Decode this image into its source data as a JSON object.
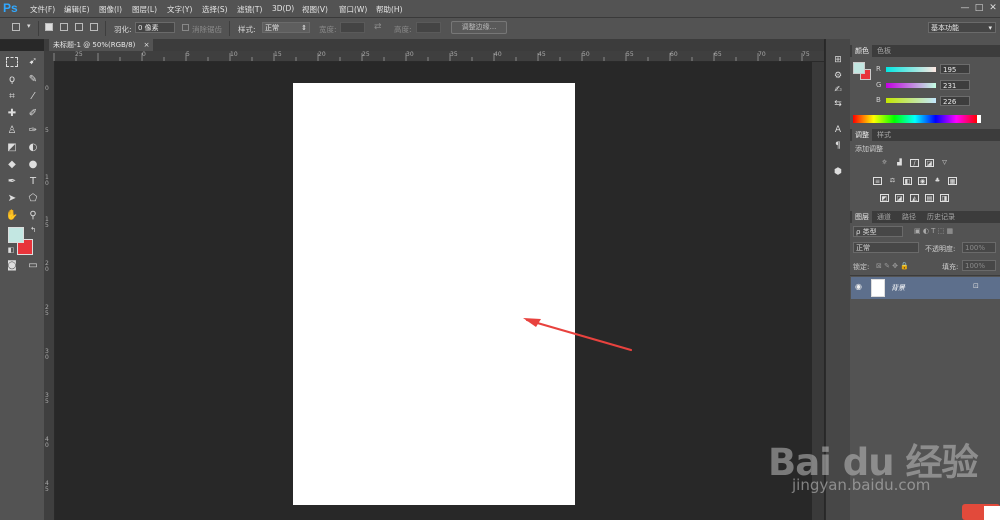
{
  "menubar": {
    "logo": "Ps",
    "items": [
      "文件(F)",
      "编辑(E)",
      "图像(I)",
      "图层(L)",
      "文字(Y)",
      "选择(S)",
      "滤镜(T)",
      "3D(D)",
      "视图(V)",
      "窗口(W)",
      "帮助(H)"
    ],
    "window_controls": [
      "—",
      "□",
      "✕"
    ]
  },
  "options": {
    "feather_label": "羽化:",
    "feather_value": "0 像素",
    "antialias_label": "消除锯齿",
    "style_label": "样式:",
    "style_value": "正常",
    "width_label": "宽度:",
    "height_label": "高度:",
    "refine_edge_button": "调整边缘...",
    "workspace_value": "基本功能"
  },
  "document": {
    "tab_title": "未标题-1 @ 50%(RGB/8)",
    "tab_close": "×"
  },
  "rulers": {
    "top_labels": [
      "25",
      "0",
      "5",
      "10",
      "15",
      "20",
      "25",
      "30",
      "35",
      "40",
      "45",
      "50",
      "55",
      "60",
      "65",
      "70",
      "75",
      "80"
    ],
    "left_labels": [
      "0",
      "5",
      "1 0",
      "1 5",
      "2 0",
      "2 5",
      "3 0",
      "3 5",
      "4 0",
      "4 5"
    ]
  },
  "tools": {
    "foreground_color": "#c3e7e2",
    "background_color": "#e8343b"
  },
  "color_panel": {
    "tabs": [
      "颜色",
      "色板"
    ],
    "channels": [
      {
        "label": "R",
        "value": "195"
      },
      {
        "label": "G",
        "value": "231"
      },
      {
        "label": "B",
        "value": "226"
      }
    ]
  },
  "adjust_panel": {
    "tabs": [
      "调整",
      "样式"
    ],
    "title": "添加调整"
  },
  "layers_panel": {
    "tabs": [
      "图层",
      "通道",
      "路径",
      "历史记录"
    ],
    "filter_label": "ρ 类型",
    "blend_mode": "正常",
    "opacity_label": "不透明度:",
    "opacity_value": "100%",
    "lock_label": "锁定:",
    "fill_label": "填充:",
    "fill_value": "100%",
    "layer_name": "背景"
  },
  "watermark": {
    "brand": "Bai du 经验",
    "url": "jingyan.baidu.com"
  },
  "annotation": {
    "arrow_color": "#e8423e"
  }
}
